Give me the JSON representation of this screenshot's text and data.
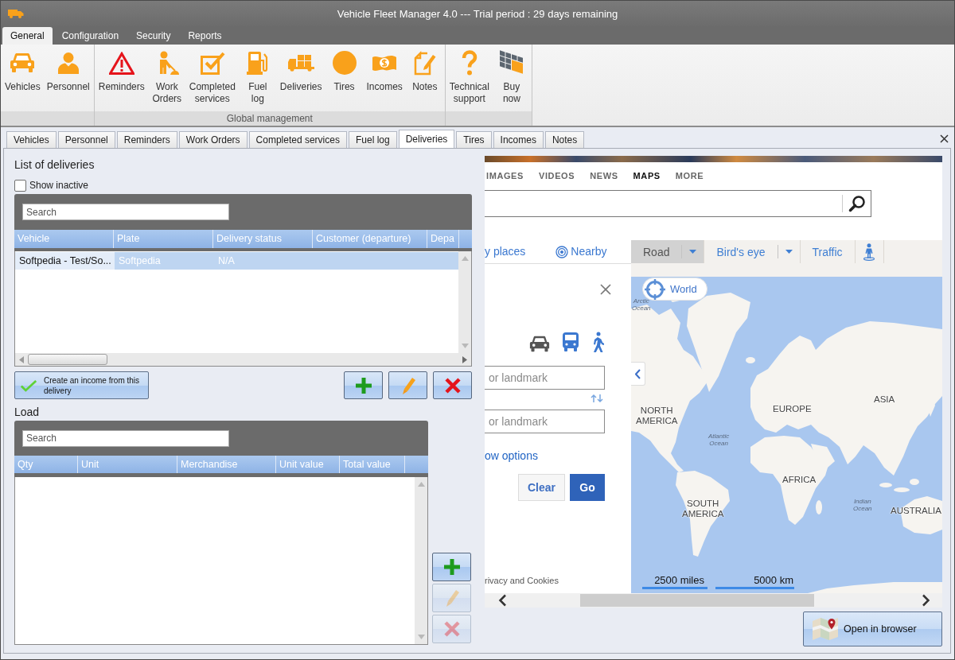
{
  "window": {
    "title": "Vehicle Fleet Manager 4.0 --- Trial period : 29 days remaining"
  },
  "ribbon_tabs": [
    {
      "label": "General",
      "selected": true
    },
    {
      "label": "Configuration",
      "selected": false
    },
    {
      "label": "Security",
      "selected": false
    },
    {
      "label": "Reports",
      "selected": false
    }
  ],
  "ribbon_groups": [
    {
      "items": [
        {
          "kind": "car",
          "label": "Vehicles"
        },
        {
          "kind": "person",
          "label": "Personnel"
        }
      ]
    },
    {
      "label": "Global management",
      "items": [
        {
          "kind": "warning",
          "label": "Reminders"
        },
        {
          "kind": "worker",
          "label": "Work Orders"
        },
        {
          "kind": "checkbox",
          "label": "Completed services"
        },
        {
          "kind": "fuel",
          "label": "Fuel log"
        },
        {
          "kind": "delivery",
          "label": "Deliveries"
        },
        {
          "kind": "tire",
          "label": "Tires"
        },
        {
          "kind": "money",
          "label": "Incomes"
        },
        {
          "kind": "note",
          "label": "Notes"
        }
      ]
    },
    {
      "items": [
        {
          "kind": "help",
          "label": "Technical support"
        },
        {
          "kind": "solar",
          "label": "Buy now"
        }
      ]
    }
  ],
  "document_tabs": [
    {
      "label": "Vehicles",
      "selected": false
    },
    {
      "label": "Personnel",
      "selected": false
    },
    {
      "label": "Reminders",
      "selected": false
    },
    {
      "label": "Work Orders",
      "selected": false
    },
    {
      "label": "Completed services",
      "selected": false
    },
    {
      "label": "Fuel log",
      "selected": false
    },
    {
      "label": "Deliveries",
      "selected": true
    },
    {
      "label": "Tires",
      "selected": false
    },
    {
      "label": "Incomes",
      "selected": false
    },
    {
      "label": "Notes",
      "selected": false
    }
  ],
  "deliveries": {
    "title": "List of deliveries",
    "show_inactive": {
      "label": "Show inactive",
      "checked": false
    },
    "search": {
      "placeholder": "Search"
    },
    "columns": [
      "Vehicle",
      "Plate",
      "Delivery status",
      "Customer (departure)",
      "Depa"
    ],
    "rows": [
      {
        "selected": true,
        "cells": [
          {
            "text": "Softpedia - Test/So...",
            "focused": true
          },
          {
            "text": "Softpedia",
            "focused": false
          },
          {
            "text": "N/A",
            "focused": false
          }
        ]
      }
    ],
    "create_income_button": {
      "label": "Create an income from this delivery"
    },
    "buttons": [
      {
        "kind": "add",
        "disabled": false
      },
      {
        "kind": "edit",
        "disabled": false
      },
      {
        "kind": "delete",
        "disabled": false
      }
    ]
  },
  "load": {
    "title": "Load",
    "search": {
      "placeholder": "Search"
    },
    "columns": [
      "Qty",
      "Unit",
      "Merchandise",
      "Unit value",
      "Total value"
    ],
    "buttons": [
      {
        "kind": "add",
        "disabled": false
      },
      {
        "kind": "edit",
        "disabled": true
      },
      {
        "kind": "delete",
        "disabled": true
      }
    ]
  },
  "web_page": {
    "nav_links": [
      {
        "label": "IMAGES",
        "selected": false
      },
      {
        "label": "VIDEOS",
        "selected": false
      },
      {
        "label": "NEWS",
        "selected": false
      },
      {
        "label": "MAPS",
        "selected": true
      },
      {
        "label": "MORE",
        "selected": false
      }
    ],
    "links": [
      {
        "kind": "plain",
        "label": "y places"
      },
      {
        "kind": "nearby",
        "label": "Nearby"
      }
    ],
    "map_types": [
      {
        "label": "Road",
        "selected": true,
        "dropdown": true
      },
      {
        "label": "Bird's eye",
        "selected": false,
        "dropdown": true
      },
      {
        "label": "Traffic",
        "selected": false,
        "dropdown": false
      }
    ],
    "directions": {
      "modes": [
        {
          "kind": "car",
          "selected": true
        },
        {
          "kind": "bus",
          "selected": false
        },
        {
          "kind": "walk",
          "selected": false
        }
      ],
      "fields": [
        {
          "placeholder": "or landmark"
        },
        {
          "placeholder": "or landmark"
        }
      ],
      "options_link": "ow options",
      "buttons": [
        {
          "kind": "secondary",
          "label": "Clear"
        },
        {
          "kind": "primary",
          "label": "Go"
        }
      ]
    },
    "footer_link": "rivacy and Cookies",
    "map": {
      "locate_button": "World",
      "labels": [
        {
          "kind": "ocean",
          "text": "Arctic Ocean"
        },
        {
          "kind": "continent",
          "text": "NORTH AMERICA"
        },
        {
          "kind": "ocean",
          "text": "Atlantic Ocean"
        },
        {
          "kind": "continent",
          "text": "EUROPE"
        },
        {
          "kind": "continent",
          "text": "ASIA"
        },
        {
          "kind": "continent",
          "text": "AFRICA"
        },
        {
          "kind": "continent",
          "text": "SOUTH AMERICA"
        },
        {
          "kind": "ocean",
          "text": "Indian Ocean"
        },
        {
          "kind": "continent",
          "text": "AUSTRALIA"
        }
      ],
      "scales": [
        "2500 miles",
        "5000 km"
      ]
    }
  },
  "open_in_browser_button": {
    "label": "Open in browser"
  }
}
